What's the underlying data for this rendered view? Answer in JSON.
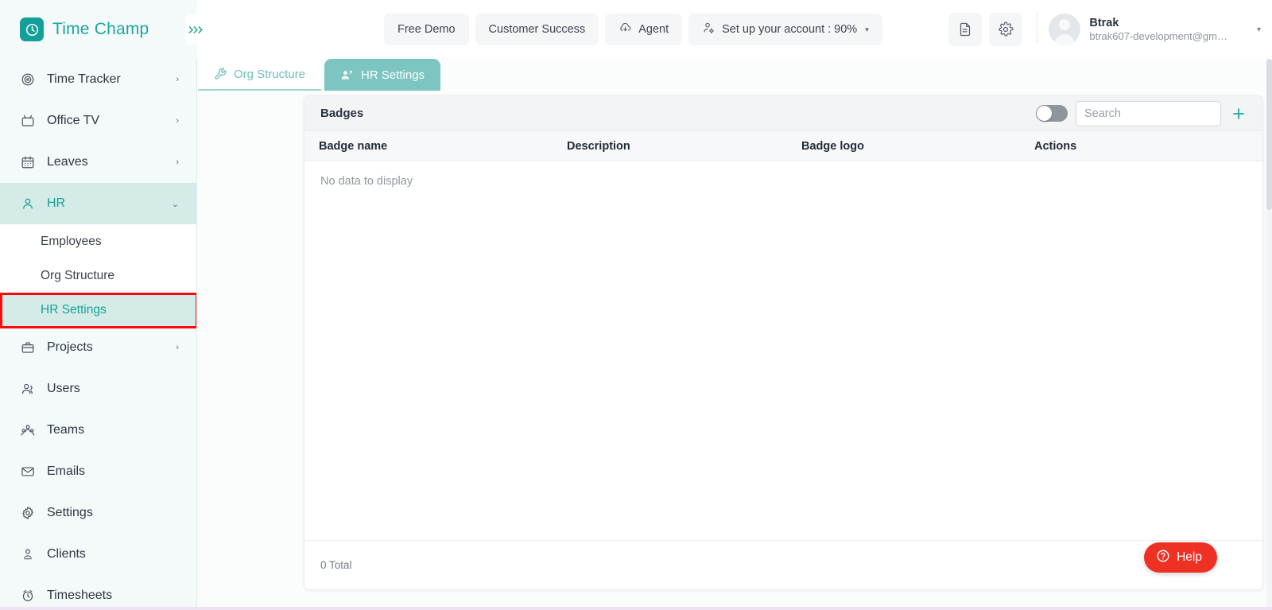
{
  "brand": {
    "name": "Time Champ",
    "logo_icon": "clock-icon",
    "accent": "#17a198"
  },
  "topbar": {
    "collapse_icon": "double-chevron-right-icon",
    "pills": [
      {
        "label": "Free Demo",
        "icon": null
      },
      {
        "label": "Customer Success",
        "icon": null
      },
      {
        "label": "Agent",
        "icon": "cloud-download-icon"
      },
      {
        "label": "Set up your account : 90%",
        "icon": "user-gear-icon",
        "caret": "▾"
      }
    ],
    "icon_buttons": [
      {
        "name": "document-icon"
      },
      {
        "name": "gear-icon"
      }
    ],
    "user": {
      "name": "Btrak",
      "email": "btrak607-development@gm…",
      "avatar_icon": "user-avatar-icon",
      "caret": "▾"
    }
  },
  "sidebar": {
    "items": [
      {
        "label": "Time Tracker",
        "icon": "target-icon",
        "chevron": "›",
        "state": "normal"
      },
      {
        "label": "Office TV",
        "icon": "tv-icon",
        "chevron": "›",
        "state": "normal"
      },
      {
        "label": "Leaves",
        "icon": "calendar-icon",
        "chevron": "›",
        "state": "normal"
      },
      {
        "label": "HR",
        "icon": "user-icon",
        "chevron": "⌄",
        "state": "active"
      }
    ],
    "sub_items": [
      {
        "label": "Employees",
        "state": "normal"
      },
      {
        "label": "Org Structure",
        "state": "normal"
      },
      {
        "label": "HR Settings",
        "state": "selected",
        "highlight": "#fa0b0b"
      }
    ],
    "items_after": [
      {
        "label": "Projects",
        "icon": "briefcase-icon",
        "chevron": "›",
        "state": "normal"
      },
      {
        "label": "Users",
        "icon": "users-icon",
        "chevron": "",
        "state": "normal"
      },
      {
        "label": "Teams",
        "icon": "team-icon",
        "chevron": "",
        "state": "normal"
      },
      {
        "label": "Emails",
        "icon": "envelope-icon",
        "chevron": "",
        "state": "normal"
      },
      {
        "label": "Settings",
        "icon": "gear-icon",
        "chevron": "",
        "state": "normal"
      },
      {
        "label": "Clients",
        "icon": "client-icon",
        "chevron": "",
        "state": "normal"
      },
      {
        "label": "Timesheets",
        "icon": "clock-icon",
        "chevron": "",
        "state": "normal"
      }
    ]
  },
  "tabs": [
    {
      "label": "Org Structure",
      "icon": "tools-icon",
      "active": false
    },
    {
      "label": "HR Settings",
      "icon": "user-badge-icon",
      "active": true
    }
  ],
  "panel": {
    "title": "Badges",
    "toggle": {
      "name": "archived-toggle",
      "on": false
    },
    "search": {
      "placeholder": "Search",
      "value": ""
    },
    "add_icon": "plus-icon",
    "columns": [
      "Badge name",
      "Description",
      "Badge logo",
      "Actions"
    ],
    "rows": [],
    "empty_message": "No data to display",
    "footer_total": "0 Total"
  },
  "help": {
    "label": "Help",
    "icon": "question-circle-icon",
    "color": "#ef3124"
  }
}
